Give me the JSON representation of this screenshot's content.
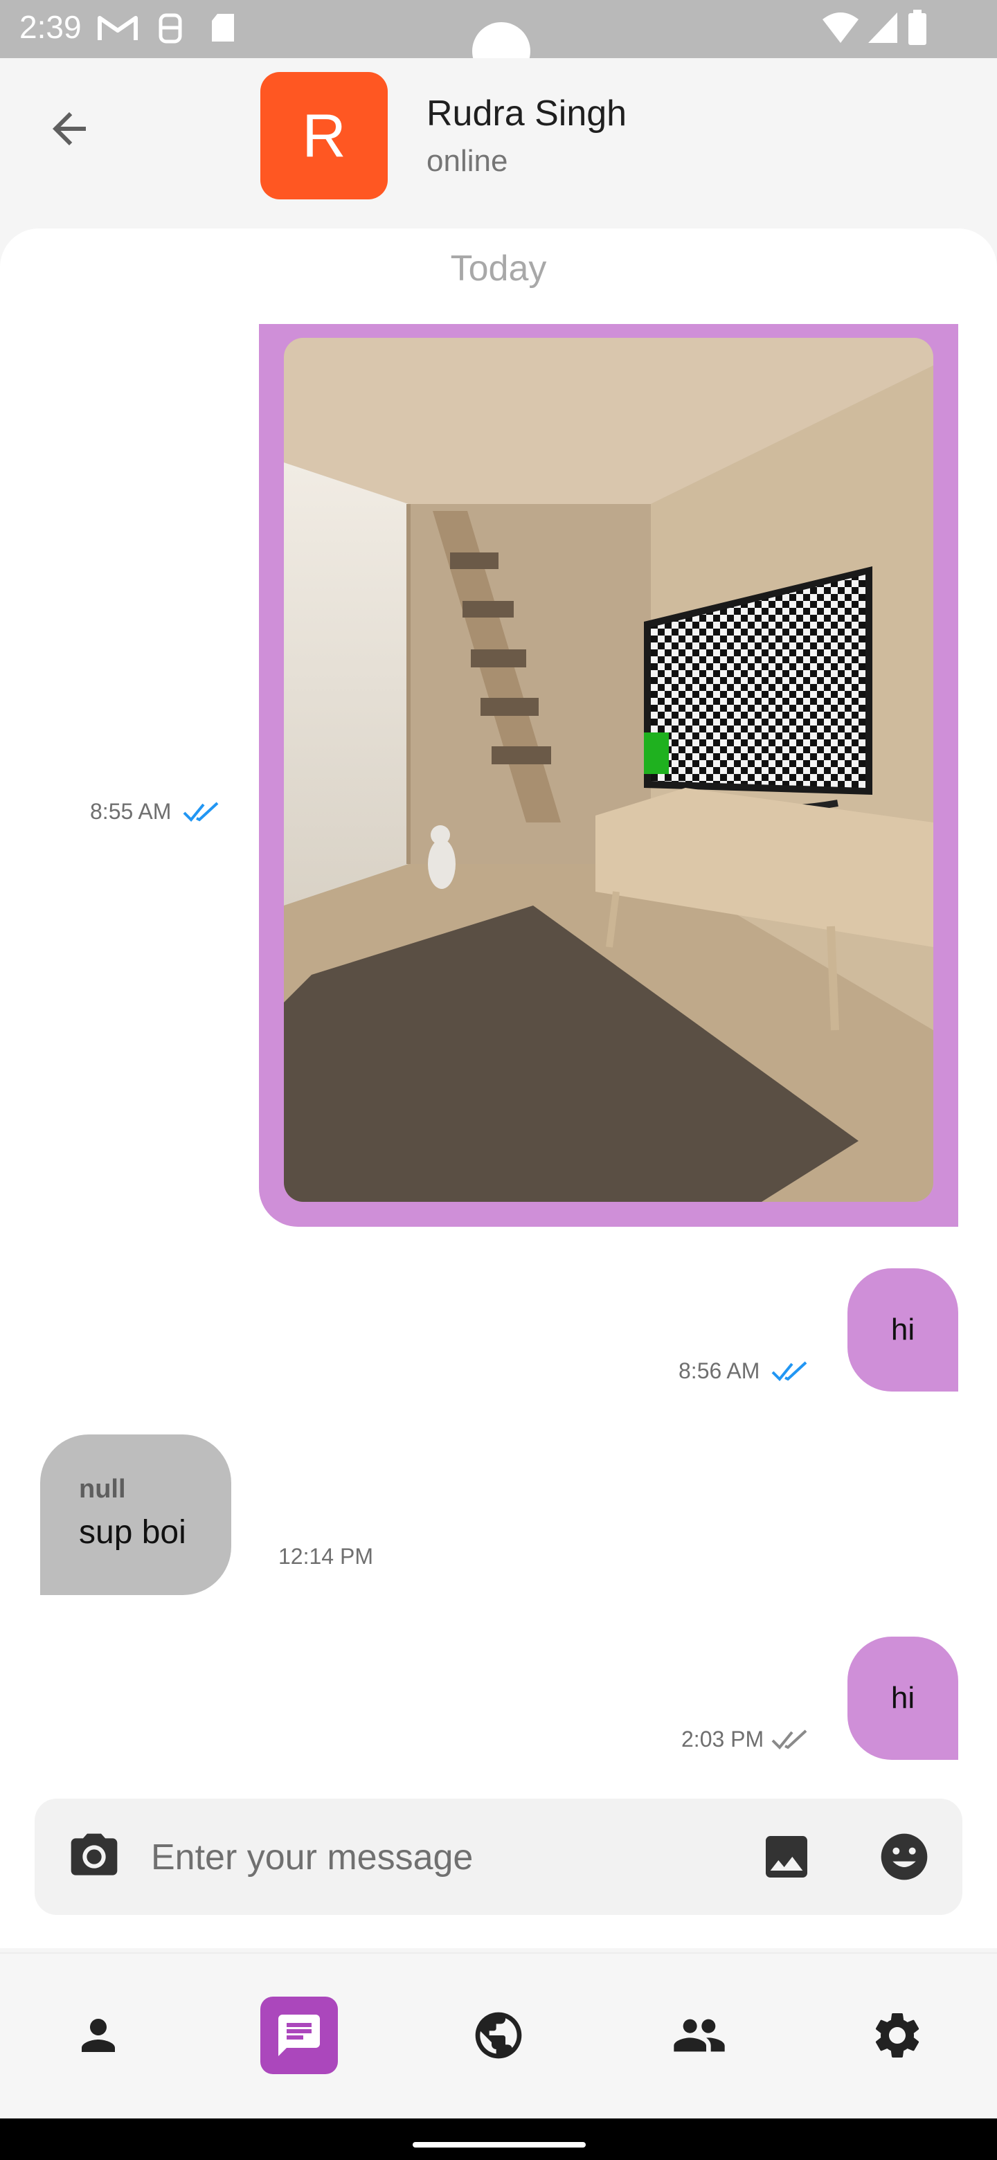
{
  "status_bar": {
    "time": "2:39"
  },
  "header": {
    "avatar_letter": "R",
    "name": "Rudra Singh",
    "status": "online"
  },
  "chat": {
    "date_separator": "Today",
    "messages": [
      {
        "type": "image",
        "direction": "outgoing",
        "time": "8:55 AM",
        "read": true
      },
      {
        "type": "text",
        "direction": "outgoing",
        "text": "hi",
        "time": "8:56 AM",
        "read": true
      },
      {
        "type": "text",
        "direction": "incoming",
        "sender": "null",
        "text": "sup boi",
        "time": "12:14 PM"
      },
      {
        "type": "text",
        "direction": "outgoing",
        "text": "hi",
        "time": "2:03 PM",
        "read": false
      }
    ]
  },
  "composer": {
    "placeholder": "Enter your message"
  },
  "nav": {
    "items": [
      {
        "icon": "person-icon",
        "active": false
      },
      {
        "icon": "chat-icon",
        "active": true
      },
      {
        "icon": "globe-icon",
        "active": false
      },
      {
        "icon": "group-icon",
        "active": false
      },
      {
        "icon": "settings-icon",
        "active": false
      }
    ]
  },
  "colors": {
    "accent": "#ab47bc",
    "bubble_outgoing": "#cf8fd8",
    "bubble_incoming": "#bdbdbd",
    "avatar": "#ff5722",
    "read_tick": "#2196f3",
    "unread_tick": "#8a8a8a"
  }
}
